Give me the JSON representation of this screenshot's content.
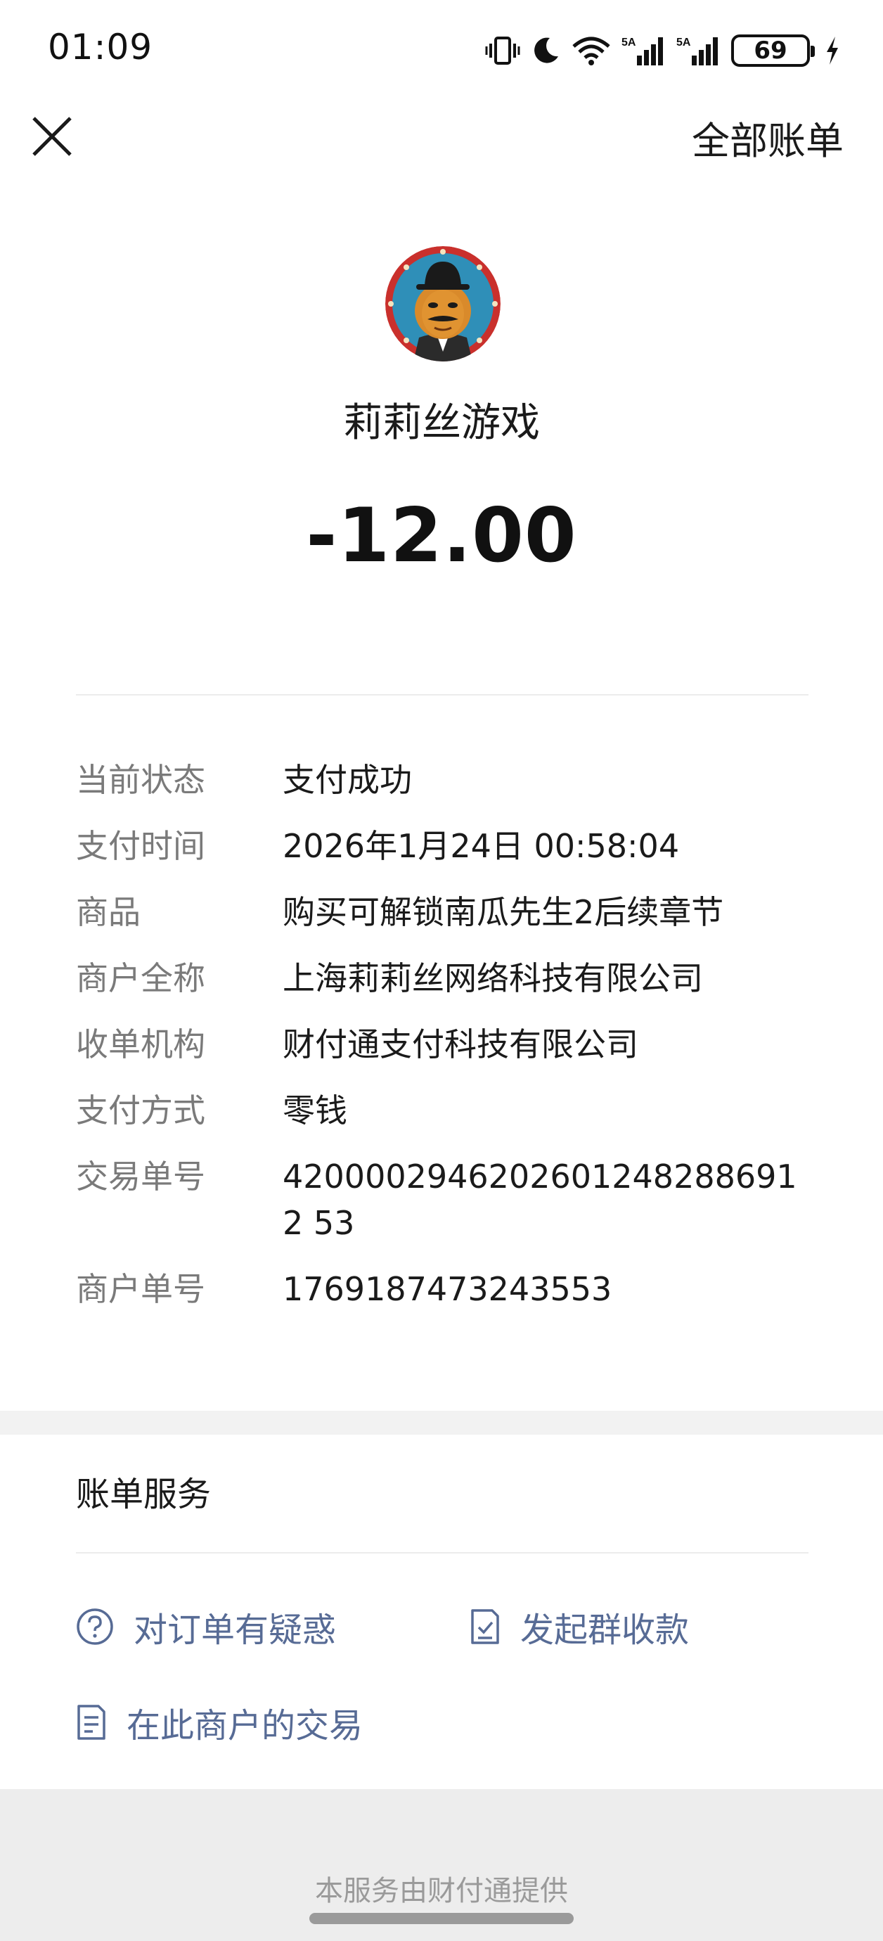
{
  "status_bar": {
    "time": "01:09",
    "battery": "69",
    "icons": [
      "vibrate-icon",
      "moon-icon",
      "wifi-icon",
      "signal-5a-icon",
      "signal-5a-icon",
      "battery-icon",
      "charging-icon"
    ],
    "signal_label": "5A"
  },
  "nav": {
    "close_icon": "close-icon",
    "all_bills": "全部账单"
  },
  "merchant": {
    "name": "莉莉丝游戏",
    "amount": "-12.00"
  },
  "details": [
    {
      "label": "当前状态",
      "value": "支付成功"
    },
    {
      "label": "支付时间",
      "value": "2026年1月24日 00:58:04"
    },
    {
      "label": "商品",
      "value": "购买可解锁南瓜先生2后续章节"
    },
    {
      "label": "商户全称",
      "value": "上海莉莉丝网络科技有限公司"
    },
    {
      "label": "收单机构",
      "value": "财付通支付科技有限公司"
    },
    {
      "label": "支付方式",
      "value": "零钱"
    },
    {
      "label": "交易单号",
      "value": "42000029462026012482886912 53"
    },
    {
      "label": "商户单号",
      "value": "1769187473243553"
    }
  ],
  "services": {
    "title": "账单服务",
    "items": [
      {
        "label": "对订单有疑惑",
        "icon": "question-icon"
      },
      {
        "label": "发起群收款",
        "icon": "document-check-icon"
      },
      {
        "label": "在此商户的交易",
        "icon": "list-doc-icon"
      }
    ]
  },
  "footer": {
    "text": "本服务由财付通提供"
  },
  "colors": {
    "link": "#576b95",
    "label": "#7a7a7a",
    "band": "#f2f2f2"
  }
}
